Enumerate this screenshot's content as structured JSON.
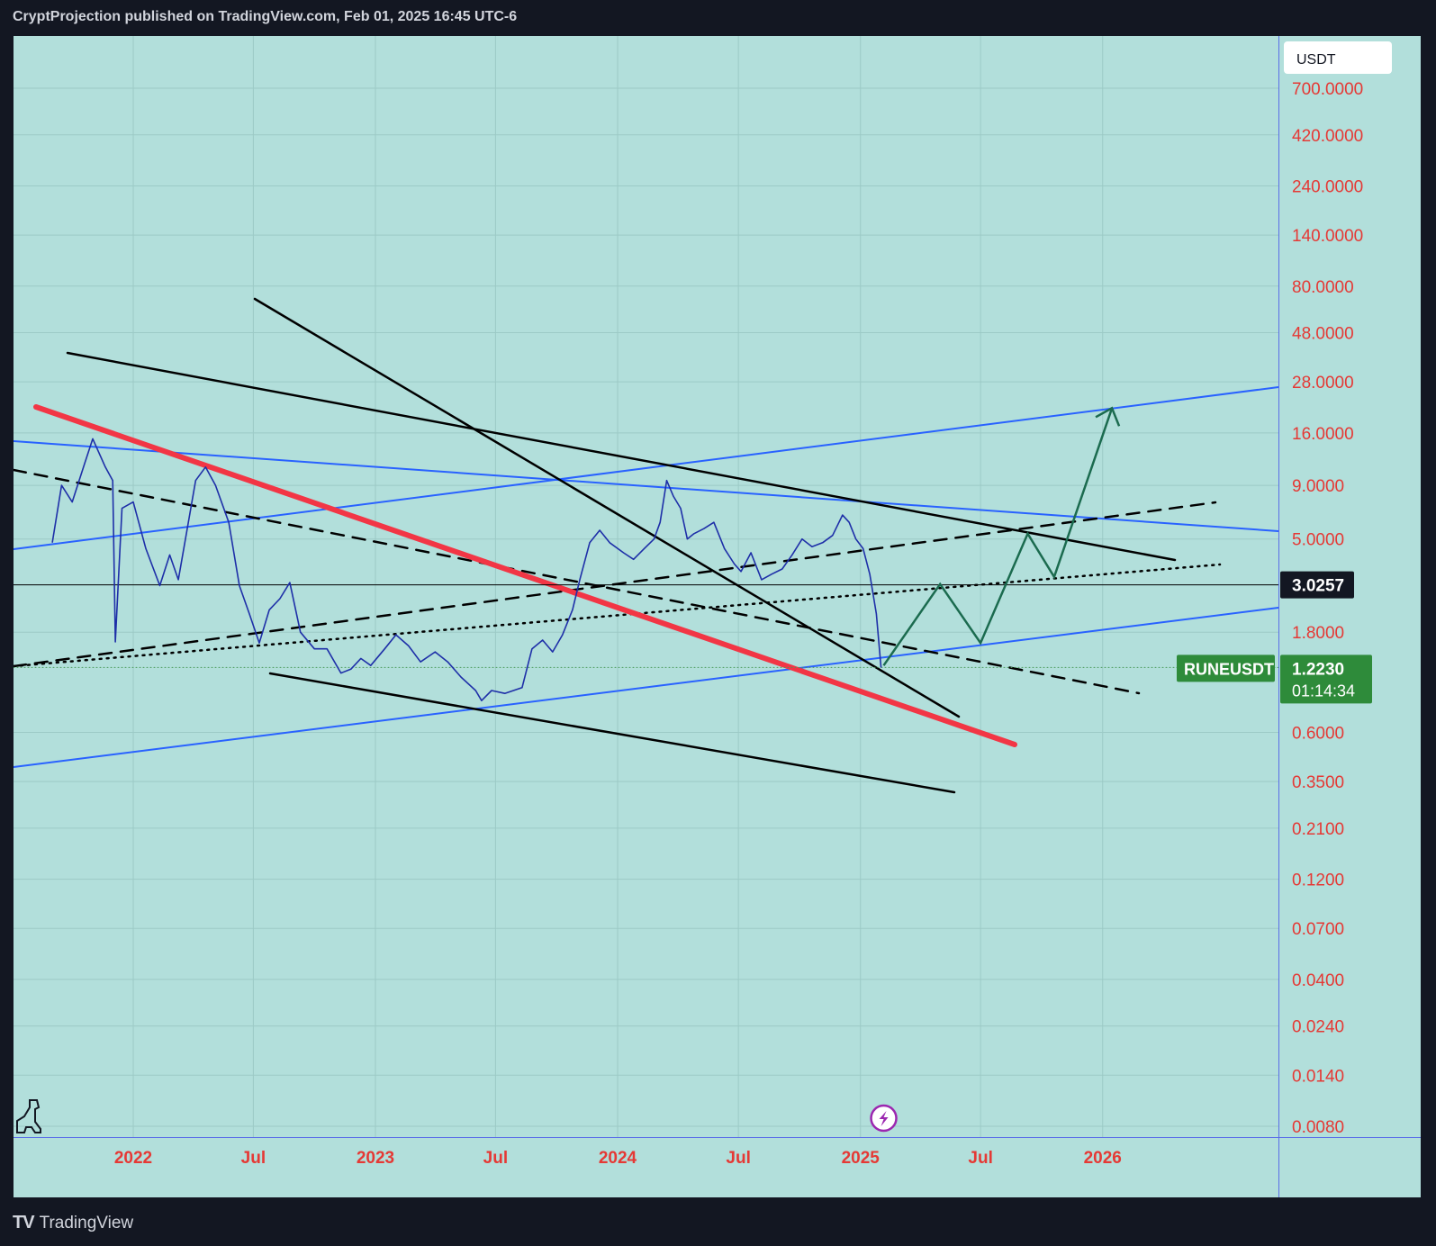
{
  "header": {
    "publisher_line": "CryptProjection published on TradingView.com, Feb 01, 2025 16:45 UTC-6"
  },
  "footer": {
    "brand": "TradingView"
  },
  "colors": {
    "background": "#b2dfdb",
    "axis_text": "#e53935",
    "price_line": "#1e2fa8",
    "channel_blue": "#2962ff",
    "red_trendline": "#f23645",
    "projection_green": "#1b6b4f",
    "symbol_badge": "#2e8b3a"
  },
  "chart_data": {
    "type": "line",
    "symbol": "RUNEUSDT",
    "currency": "USDT",
    "scale": "log",
    "grid": true,
    "ylim": [
      0.008,
      700
    ],
    "y_ticks": [
      "700.0000",
      "420.0000",
      "240.0000",
      "140.0000",
      "80.0000",
      "48.0000",
      "28.0000",
      "16.0000",
      "9.0000",
      "5.0000",
      "1.8000",
      "0.6000",
      "0.3500",
      "0.2100",
      "0.1200",
      "0.0700",
      "0.0400",
      "0.0240",
      "0.0140",
      "0.0080"
    ],
    "x_ticks": [
      "2022",
      "Jul",
      "2023",
      "Jul",
      "2024",
      "Jul",
      "2025",
      "Jul",
      "2026"
    ],
    "current_price": "1.2230",
    "countdown": "01:14:34",
    "crosshair_price": "3.0257",
    "series": [
      {
        "values": [
          [
            "2021-09-01",
            4.8
          ],
          [
            "2021-09-15",
            9.0
          ],
          [
            "2021-10-01",
            7.5
          ],
          [
            "2021-10-20",
            11.5
          ],
          [
            "2021-11-01",
            15.0
          ],
          [
            "2021-11-20",
            11.0
          ],
          [
            "2021-12-01",
            9.5
          ],
          [
            "2021-12-05",
            1.62
          ],
          [
            "2021-12-15",
            7.0
          ],
          [
            "2022-01-01",
            7.5
          ],
          [
            "2022-01-20",
            4.5
          ],
          [
            "2022-02-10",
            3.0
          ],
          [
            "2022-02-25",
            4.2
          ],
          [
            "2022-03-10",
            3.2
          ],
          [
            "2022-03-25",
            6.0
          ],
          [
            "2022-04-05",
            9.5
          ],
          [
            "2022-04-20",
            11.0
          ],
          [
            "2022-05-05",
            9.0
          ],
          [
            "2022-05-25",
            6.0
          ],
          [
            "2022-06-10",
            3.0
          ],
          [
            "2022-06-25",
            2.2
          ],
          [
            "2022-07-10",
            1.6
          ],
          [
            "2022-07-25",
            2.3
          ],
          [
            "2022-08-10",
            2.6
          ],
          [
            "2022-08-25",
            3.1
          ],
          [
            "2022-09-10",
            1.8
          ],
          [
            "2022-10-01",
            1.5
          ],
          [
            "2022-10-20",
            1.5
          ],
          [
            "2022-11-10",
            1.15
          ],
          [
            "2022-11-25",
            1.2
          ],
          [
            "2022-12-10",
            1.35
          ],
          [
            "2022-12-25",
            1.25
          ],
          [
            "2023-01-15",
            1.5
          ],
          [
            "2023-02-01",
            1.75
          ],
          [
            "2023-02-20",
            1.55
          ],
          [
            "2023-03-10",
            1.3
          ],
          [
            "2023-04-01",
            1.45
          ],
          [
            "2023-04-20",
            1.3
          ],
          [
            "2023-05-10",
            1.1
          ],
          [
            "2023-06-01",
            0.95
          ],
          [
            "2023-06-10",
            0.85
          ],
          [
            "2023-06-25",
            0.95
          ],
          [
            "2023-07-15",
            0.92
          ],
          [
            "2023-08-10",
            0.98
          ],
          [
            "2023-08-25",
            1.5
          ],
          [
            "2023-09-10",
            1.65
          ],
          [
            "2023-09-25",
            1.45
          ],
          [
            "2023-10-10",
            1.75
          ],
          [
            "2023-10-25",
            2.3
          ],
          [
            "2023-11-05",
            3.2
          ],
          [
            "2023-11-20",
            4.8
          ],
          [
            "2023-12-05",
            5.5
          ],
          [
            "2023-12-20",
            4.8
          ],
          [
            "2024-01-10",
            4.3
          ],
          [
            "2024-01-25",
            4.0
          ],
          [
            "2024-02-10",
            4.5
          ],
          [
            "2024-02-25",
            5.0
          ],
          [
            "2024-03-05",
            6.0
          ],
          [
            "2024-03-15",
            9.5
          ],
          [
            "2024-03-25",
            8.0
          ],
          [
            "2024-04-05",
            7.0
          ],
          [
            "2024-04-15",
            5.0
          ],
          [
            "2024-04-25",
            5.3
          ],
          [
            "2024-05-10",
            5.6
          ],
          [
            "2024-05-25",
            6.0
          ],
          [
            "2024-06-10",
            4.5
          ],
          [
            "2024-06-25",
            3.8
          ],
          [
            "2024-07-05",
            3.5
          ],
          [
            "2024-07-20",
            4.3
          ],
          [
            "2024-08-05",
            3.2
          ],
          [
            "2024-08-20",
            3.4
          ],
          [
            "2024-09-05",
            3.6
          ],
          [
            "2024-09-20",
            4.2
          ],
          [
            "2024-10-05",
            5.0
          ],
          [
            "2024-10-20",
            4.6
          ],
          [
            "2024-11-05",
            4.8
          ],
          [
            "2024-11-20",
            5.2
          ],
          [
            "2024-12-05",
            6.5
          ],
          [
            "2024-12-15",
            6.0
          ],
          [
            "2024-12-25",
            5.0
          ],
          [
            "2025-01-05",
            4.5
          ],
          [
            "2025-01-15",
            3.4
          ],
          [
            "2025-01-25",
            2.2
          ],
          [
            "2025-02-01",
            1.22
          ]
        ]
      }
    ],
    "projection_path": [
      [
        "2025-02-05",
        1.25
      ],
      [
        "2025-05-01",
        3.05
      ],
      [
        "2025-07-01",
        1.6
      ],
      [
        "2025-09-10",
        5.3
      ],
      [
        "2025-10-20",
        3.3
      ],
      [
        "2026-01-15",
        21.0
      ]
    ]
  }
}
